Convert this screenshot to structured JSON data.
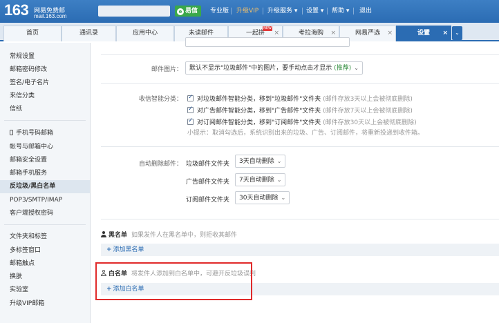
{
  "colors": {
    "brand": "#2b6cb3",
    "highlight": "#e02a2a",
    "recommend": "#2f8c3c",
    "yixin": "#3aa84a",
    "vip": "#f5c26b"
  },
  "header": {
    "logo_num": "163",
    "logo_title": "网易免费邮",
    "logo_domain": "mail.163.com",
    "yixin": "易信",
    "links": [
      "专业版",
      "升级VIP",
      "升级服务 ▾",
      "设置 ▾",
      "帮助 ▾",
      "退出"
    ]
  },
  "tabs": [
    {
      "label": "首页"
    },
    {
      "label": "通讯录"
    },
    {
      "label": "应用中心"
    },
    {
      "label": "未读邮件"
    },
    {
      "label": "一起拼",
      "badge": "NEW"
    },
    {
      "label": "考拉海购"
    },
    {
      "label": "网易严选"
    },
    {
      "label": "设置",
      "active": true
    }
  ],
  "sidebar": {
    "items": [
      "常规设置",
      "邮箱密码修改",
      "签名/电子名片",
      "来信分类",
      "信纸",
      "手机号码邮箱",
      "帐号与邮箱中心",
      "邮箱安全设置",
      "邮箱手机服务",
      "反垃圾/黑白名单",
      "POP3/SMTP/IMAP",
      "客户端授权密码",
      "文件夹和标签",
      "多标签窗口",
      "邮箱触点",
      "换肤",
      "实验室",
      "升级VIP邮箱"
    ]
  },
  "main": {
    "images_label": "邮件图片：",
    "images_select": "默认不显示\"垃圾邮件\"中的图片，要手动点击才显示",
    "images_select_rec": "(推荐)",
    "smart_label": "收信智能分类：",
    "smart_options": [
      {
        "text": "对垃圾邮件智能分类，移到\"垃圾邮件\"文件夹",
        "note": "(邮件存放3天以上会被彻底删除)"
      },
      {
        "text": "对广告邮件智能分类，移到\"广告邮件\"文件夹",
        "note": "(邮件存放7天以上会被彻底删除)"
      },
      {
        "text": "对订阅邮件智能分类，移到\"订阅邮件\"文件夹",
        "note": "(邮件存放30天以上会被彻底删除)"
      }
    ],
    "smart_tip": "小提示：取消勾选后，系统识别出来的垃圾、广告、订阅邮件，将重新投递到收件箱。",
    "autodel_label": "自动删除邮件：",
    "autodel_rows": [
      {
        "folder": "垃圾邮件文件夹",
        "value": "3天自动删除"
      },
      {
        "folder": "广告邮件文件夹",
        "value": "7天自动删除"
      },
      {
        "folder": "订阅邮件文件夹",
        "value": "30天自动删除"
      }
    ],
    "blacklist_title": "黑名单",
    "blacklist_desc": "如果发件人在黑名单中，则拒收其邮件",
    "blacklist_add": "添加黑名单",
    "whitelist_title": "白名单",
    "whitelist_desc": "将发件人添加到白名单中，可避开反垃圾误判",
    "whitelist_add": "添加白名单"
  }
}
